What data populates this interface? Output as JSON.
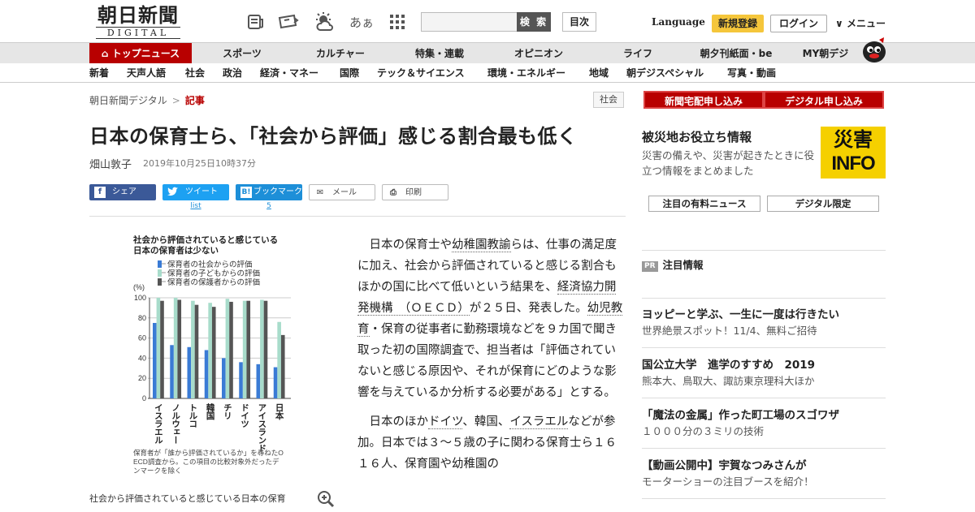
{
  "header": {
    "logo_main": "朝日新聞",
    "logo_sub": "DIGITAL",
    "search_button": "検 索",
    "toc_button": "目次",
    "language": "Language",
    "register": "新規登録",
    "login": "ログイン",
    "menu": "メニュー",
    "icons": [
      "newspaper-icon",
      "ticket-icon",
      "weather-icon",
      "font-size-icon",
      "grid-icon"
    ],
    "font_size_glyph": "あぁ"
  },
  "nav_primary": [
    "トップニュース",
    "スポーツ",
    "カルチャー",
    "特集・連載",
    "オピニオン",
    "ライフ",
    "朝夕刊紙面・be",
    "MY朝デジ"
  ],
  "nav_secondary": [
    "新着",
    "天声人語",
    "社会",
    "政治",
    "経済・マネー",
    "国際",
    "テック＆サイエンス",
    "環境・エネルギー",
    "地域",
    "朝デジスペシャル",
    "写真・動画"
  ],
  "breadcrumb": {
    "home": "朝日新聞デジタル",
    "sep": ">",
    "current": "記事"
  },
  "category_tag": "社会",
  "article": {
    "title": "日本の保育士ら、「社会から評価」感じる割合最も低く",
    "author": "畑山敦子",
    "date": "2019年10月25日10時37分",
    "share": {
      "facebook": "シェア",
      "twitter": "ツイート",
      "hatena": "ブックマーク",
      "mail": "メール",
      "print": "印刷",
      "twitter_count": "list",
      "hatena_count": "5"
    },
    "caption": "社会から評価されていると感じている日本の保育",
    "paragraph1": [
      "日本の保育士や",
      "幼稚園教諭",
      "らは、仕事の満足度に加え、社会から評価されていると感じる割合もほかの国に比べて低いという結果を、",
      "経済協力開発機構　（ＯＥＣＤ）",
      "が２５日、発表した。",
      "幼児教育",
      "・保育の従事者に勤務環境などを９カ国で聞き取った初の国際調査で、担当者は「評価されていないと感じる原因や、それが保育にどのような影響を与えているか分析する必要がある」とする。"
    ],
    "paragraph2": [
      "日本のほか",
      "ドイツ",
      "、韓国、",
      "イスラエル",
      "などが参加。日本では３～５歳の子に関わる保育士ら１６１６人、保育園や幼稚園の"
    ]
  },
  "chart_data": {
    "type": "bar",
    "title": "社会から評価されていると感じている日本の保育者は少ない",
    "ylabel": "(%)",
    "ylim": [
      0,
      100
    ],
    "yticks": [
      0,
      20,
      40,
      60,
      80,
      100
    ],
    "categories": [
      "イスラエル",
      "ノルウェー",
      "トルコ",
      "韓国",
      "チリ",
      "ドイツ",
      "アイスランド",
      "日本"
    ],
    "series": [
      {
        "name": "保育者の社会からの評価",
        "color": "#3a7bd5",
        "values": [
          75,
          53,
          51,
          48,
          40,
          36,
          34,
          31
        ]
      },
      {
        "name": "保育者の子どもからの評価",
        "color": "#a8dccb",
        "values": [
          100,
          100,
          97,
          95,
          99,
          97,
          98,
          76
        ]
      },
      {
        "name": "保育者の保護者からの評価",
        "color": "#555555",
        "values": [
          97,
          98,
          93,
          91,
          96,
          97,
          97,
          63
        ]
      }
    ],
    "note": "保育者が「誰から評価されているか」を尋ねたOECD調査から。この項目の比較対象外だったデンマークを除く"
  },
  "sidebar": {
    "btn_newspaper": "新聞宅配申し込み",
    "btn_digital": "デジタル申し込み",
    "disaster_title": "被災地お役立ち情報",
    "disaster_desc": "災害の備えや、災害が起きたときに役立つ情報をまとめました",
    "disaster_badge_top": "災害",
    "disaster_badge_bottom": "INFO",
    "paid_news": "注目の有料ニュース",
    "digital_only": "デジタル限定",
    "pr_label": "PR",
    "pr_heading": "注目情報",
    "pr_items": [
      {
        "title": "ヨッピーと学ぶ、一生に一度は行きたい",
        "sub": "世界絶景スポット！11/4、無料ご招待"
      },
      {
        "title": "国公立大学　進学のすすめ　2019",
        "sub": "熊本大、鳥取大、諏訪東京理科大ほか"
      },
      {
        "title": "「魔法の金属」作った町工場のスゴワザ",
        "sub": "１０００分の３ミリの技術"
      },
      {
        "title": "【動画公開中】宇賀なつみさんが",
        "sub": "モーターショーの注目ブースを紹介！"
      }
    ]
  }
}
